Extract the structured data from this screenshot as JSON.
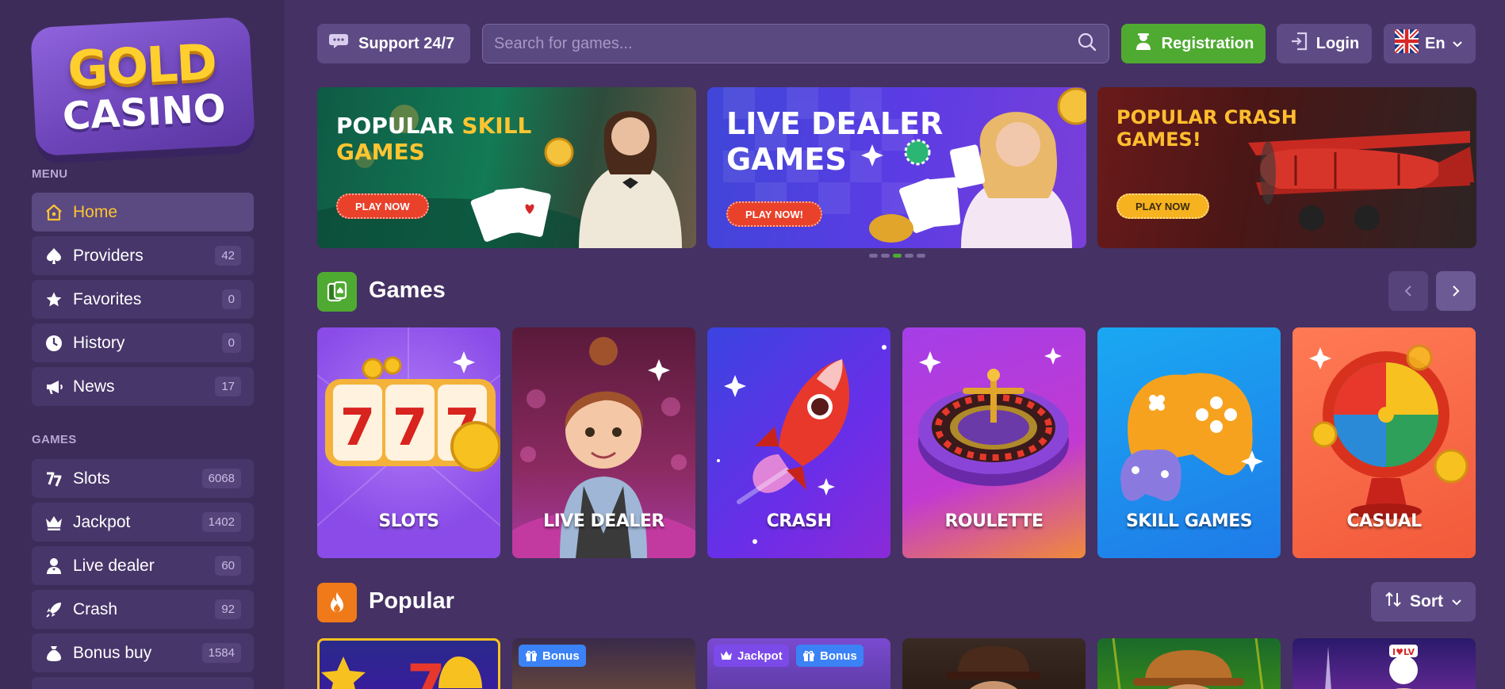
{
  "sidebar": {
    "logo": {
      "line1": "GOLD",
      "line2": "CASINO"
    },
    "menu_label": "MENU",
    "menu": [
      {
        "label": "Home",
        "count": ""
      },
      {
        "label": "Providers",
        "count": "42"
      },
      {
        "label": "Favorites",
        "count": "0"
      },
      {
        "label": "History",
        "count": "0"
      },
      {
        "label": "News",
        "count": "17"
      }
    ],
    "games_label": "GAMES",
    "games": [
      {
        "label": "Slots",
        "count": "6068"
      },
      {
        "label": "Jackpot",
        "count": "1402"
      },
      {
        "label": "Live dealer",
        "count": "60"
      },
      {
        "label": "Crash",
        "count": "92"
      },
      {
        "label": "Bonus buy",
        "count": "1584"
      }
    ]
  },
  "header": {
    "support_label": "Support 24/7",
    "search_placeholder": "Search for games...",
    "registration_label": "Registration",
    "login_label": "Login",
    "language": "En"
  },
  "banners": [
    {
      "title_a": "POPULAR ",
      "title_b": "SKILL",
      "title_c": "GAMES",
      "cta": "PLAY NOW"
    },
    {
      "title_a": "LIVE DEALER",
      "title_b": "GAMES",
      "cta": "PLAY NOW!"
    },
    {
      "title_a": "POPULAR CRASH",
      "title_b": "GAMES!",
      "cta": "PLAY NOW"
    }
  ],
  "carousel": {
    "total": 5,
    "active": 3
  },
  "games_section": {
    "title": "Games",
    "categories": [
      "SLOTS",
      "LIVE DEALER",
      "CRASH",
      "ROULETTE",
      "SKILL GAMES",
      "CASUAL"
    ]
  },
  "popular_section": {
    "title": "Popular",
    "sort_label": "Sort",
    "badges": {
      "bonus": "Bonus",
      "jackpot": "Jackpot"
    }
  },
  "colors": {
    "accent_green": "#4faa32",
    "active_yellow": "#ffc531",
    "bg": "#453163",
    "sidebar_bg": "#3d2c5a"
  }
}
